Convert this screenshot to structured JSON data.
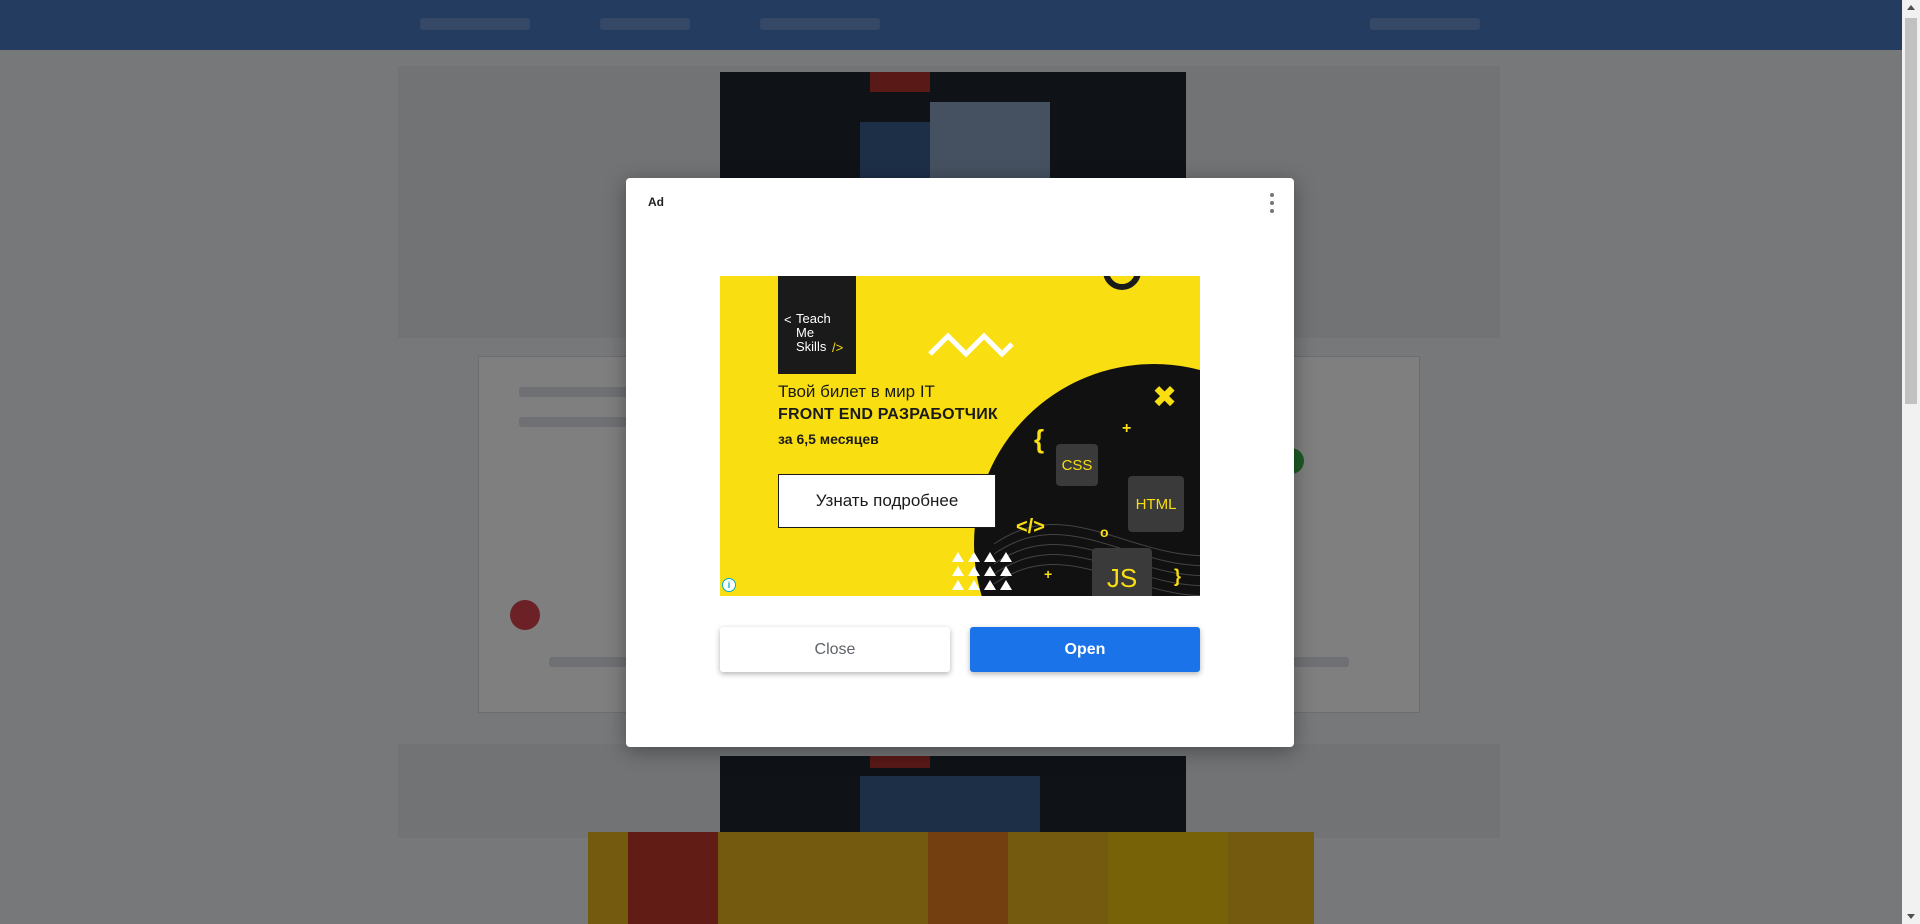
{
  "dialog": {
    "ad_label": "Ad",
    "menu_icon": "more-vert-icon",
    "creative": {
      "brand_lines": "Teach\nMe\nSkills",
      "brand_prefix": "<",
      "brand_suffix": "/>",
      "headline_1": "Твой билет в мир IT",
      "headline_2": "FRONT END РАЗРАБОТЧИК",
      "headline_3": "за 6,5 месяцев",
      "cta_label": "Узнать подробнее",
      "tiles": {
        "css": "CSS",
        "html": "HTML",
        "js": "JS"
      },
      "glyphs": {
        "brace_open": "{",
        "brace_close": "}",
        "code": "</>",
        "plus": "+",
        "cross": "✖",
        "ring": "o"
      },
      "adchoices_glyph": "i",
      "colors": {
        "background": "#f9df12",
        "dark": "#111111"
      }
    },
    "close_label": "Close",
    "open_label": "Open",
    "colors": {
      "open_button": "#1a73e8"
    }
  }
}
